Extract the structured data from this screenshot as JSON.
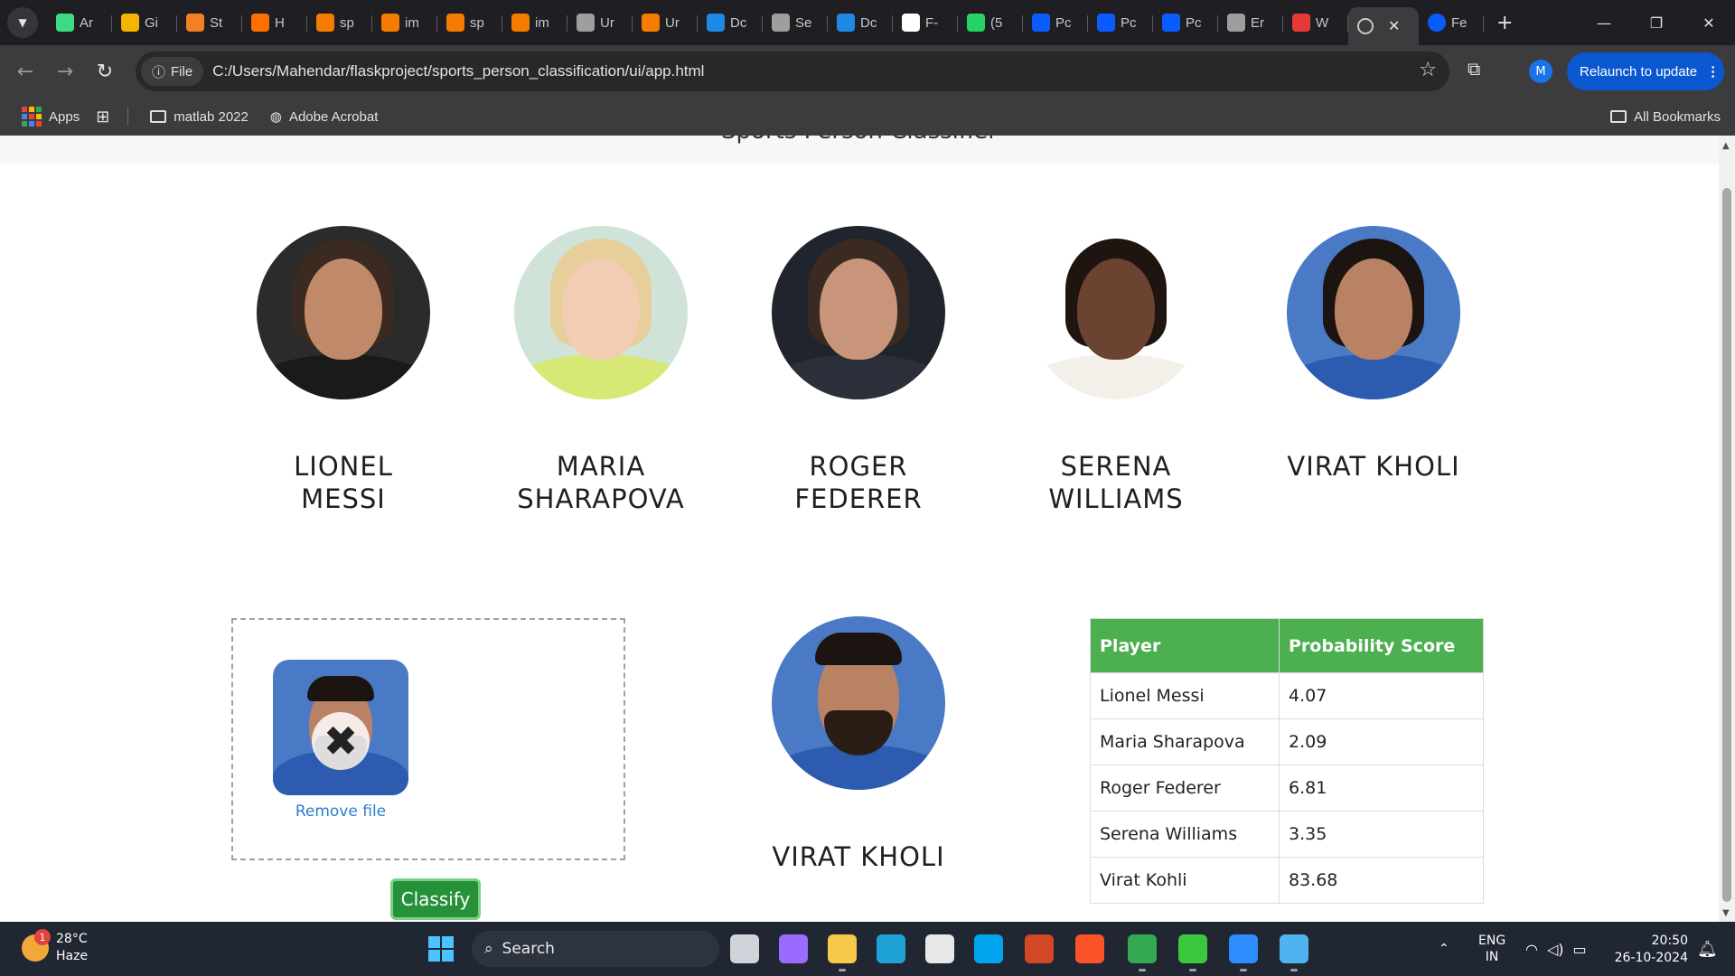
{
  "browser": {
    "tabs": [
      {
        "label": "Ar",
        "color": "#3ddc84"
      },
      {
        "label": "Gi",
        "color": "#f4b400"
      },
      {
        "label": "St",
        "color": "#f48024"
      },
      {
        "label": "H",
        "color": "#ff6f00"
      },
      {
        "label": "sp",
        "color": "#f57c00"
      },
      {
        "label": "im",
        "color": "#f57c00"
      },
      {
        "label": "sp",
        "color": "#f57c00"
      },
      {
        "label": "im",
        "color": "#f57c00"
      },
      {
        "label": "Ur",
        "color": "#9e9e9e"
      },
      {
        "label": "Ur",
        "color": "#f57c00"
      },
      {
        "label": "Dc",
        "color": "#1e88e5"
      },
      {
        "label": "Se",
        "color": "#9e9e9e"
      },
      {
        "label": "Dc",
        "color": "#1e88e5"
      },
      {
        "label": "F-",
        "color": "#ffffff"
      },
      {
        "label": "(5",
        "color": "#25d366"
      },
      {
        "label": "Pc",
        "color": "#0b5cff"
      },
      {
        "label": "Pc",
        "color": "#0b5cff"
      },
      {
        "label": "Pc",
        "color": "#0b5cff"
      },
      {
        "label": "Er",
        "color": "#9e9e9e"
      },
      {
        "label": "W",
        "color": "#e53935"
      }
    ],
    "active_tab": {
      "label": "",
      "close": "✕"
    },
    "last_tab": {
      "label": "Fe",
      "color": "#0b5cff"
    },
    "new_tab": "+",
    "window_controls": {
      "minimize": "—",
      "restore": "❐",
      "close": "✕"
    },
    "address": {
      "badge": "File",
      "url": "C:/Users/Mahendar/flaskproject/sports_person_classification/ui/app.html"
    },
    "profile_initial": "M",
    "relaunch_label": "Relaunch to update",
    "bookmarks": {
      "apps": "Apps",
      "items": [
        "matlab 2022",
        "Adobe Acrobat"
      ],
      "all": "All Bookmarks"
    }
  },
  "page": {
    "header_title": "Sports Person Classifier",
    "players": [
      {
        "line1": "LIONEL",
        "line2": "MESSI",
        "bg": "#2b2b2b",
        "skin": "#c08a6a",
        "hair": "#3a2a1f",
        "shirt": "#1a1a1a"
      },
      {
        "line1": "MARIA",
        "line2": "SHARAPOVA",
        "bg": "#cfe3d8",
        "skin": "#f2cdb3",
        "hair": "#e6cf9a",
        "shirt": "#d8e874"
      },
      {
        "line1": "ROGER",
        "line2": "FEDERER",
        "bg": "#20242c",
        "skin": "#c8957a",
        "hair": "#3a2a22",
        "shirt": "#2b2f3a"
      },
      {
        "line1": "SERENA",
        "line2": "WILLIAMS",
        "bg": "#ffffff",
        "skin": "#6b4331",
        "hair": "#1e1410",
        "shirt": "#f3f0ea"
      },
      {
        "line1": "VIRAT KHOLI",
        "line2": "",
        "bg": "#4a79c6",
        "skin": "#b98264",
        "hair": "#1c1410",
        "shirt": "#2c5bb0"
      }
    ],
    "upload": {
      "remove_label": "Remove file",
      "remove_icon": "✖"
    },
    "classify_label": "Classify",
    "result": {
      "name": "VIRAT KHOLI"
    },
    "table": {
      "headers": [
        "Player",
        "Probability Score"
      ],
      "rows": [
        [
          "Lionel Messi",
          "4.07"
        ],
        [
          "Maria Sharapova",
          "2.09"
        ],
        [
          "Roger Federer",
          "6.81"
        ],
        [
          "Serena Williams",
          "3.35"
        ],
        [
          "Virat Kohli",
          "83.68"
        ]
      ]
    }
  },
  "taskbar": {
    "weather": {
      "temp": "28°C",
      "condition": "Haze",
      "badge": "1"
    },
    "search_placeholder": "Search",
    "language": {
      "line1": "ENG",
      "line2": "IN"
    },
    "clock": {
      "time": "20:50",
      "date": "26-10-2024"
    },
    "apps": [
      {
        "name": "task-view-icon",
        "color": "#d0d4da"
      },
      {
        "name": "copilot-icon",
        "color": "#9a6bff"
      },
      {
        "name": "file-explorer-icon",
        "color": "#f7c948"
      },
      {
        "name": "edge-icon",
        "color": "#1fa3d6"
      },
      {
        "name": "store-icon",
        "color": "#e8e8e8"
      },
      {
        "name": "cortana-icon",
        "color": "#00a4ef"
      },
      {
        "name": "powerpoint-icon",
        "color": "#d24726"
      },
      {
        "name": "brave-icon",
        "color": "#fb542b"
      },
      {
        "name": "chrome-icon",
        "color": "#34a853"
      },
      {
        "name": "spinner-icon",
        "color": "#3cc83c"
      },
      {
        "name": "zoom-icon",
        "color": "#2d8cff"
      },
      {
        "name": "notepad-icon",
        "color": "#4fb3f0"
      }
    ]
  }
}
